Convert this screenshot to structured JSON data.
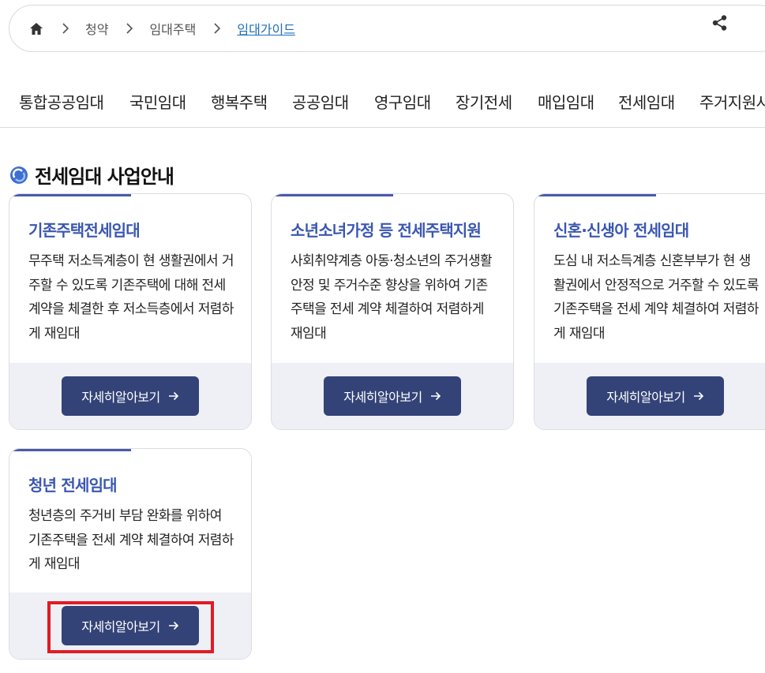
{
  "breadcrumb": {
    "items": [
      "청약",
      "임대주택",
      "임대가이드"
    ]
  },
  "tabs": [
    "통합공공임대",
    "국민임대",
    "행복주택",
    "공공임대",
    "영구임대",
    "장기전세",
    "매입임대",
    "전세임대",
    "주거지원사"
  ],
  "active_tab": "전세임대",
  "section": {
    "title": "전세임대 사업안내"
  },
  "cards": [
    {
      "title": "기존주택전세임대",
      "desc": "무주택 저소득계층이 현 생활권에서 거주할 수 있도록 기존주택에 대해 전세 계약을 체결한 후 저소득층에서 저렴하게 재임대",
      "button": "자세히알아보기"
    },
    {
      "title": "소년소녀가정 등 전세주택지원",
      "desc": "사회취약계층 아동·청소년의 주거생활 안정 및 주거수준 향상을 위하여 기존주택을 전세 계약 체결하여 저렴하게 재임대",
      "button": "자세히알아보기"
    },
    {
      "title": "신혼·신생아 전세임대",
      "desc": "도심 내 저소득계층 신혼부부가 현 생활권에서 안정적으로 거주할 수 있도록 기존주택을 전세 계약 체결하여 저렴하게 재임대",
      "button": "자세히알아보기"
    },
    {
      "title": "청년 전세임대",
      "desc": "청년층의 주거비 부담 완화를 위하여 기존주택을 전세 계약 체결하여 저렴하게 재임대",
      "button": "자세히알아보기"
    }
  ],
  "colors": {
    "accent": "#3a57b0",
    "button": "#334377",
    "highlight": "#e01b24"
  }
}
